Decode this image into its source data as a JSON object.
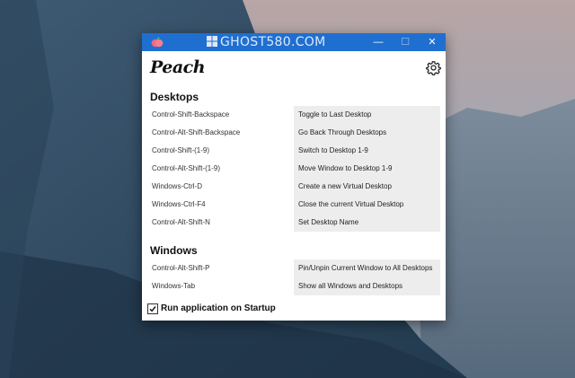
{
  "window": {
    "watermark_text": "GHOST580.COM",
    "minimize_glyph": "—",
    "maximize_glyph": "☐",
    "close_glyph": "✕"
  },
  "app": {
    "logo_text": "Peach",
    "settings_icon": "gear-icon",
    "icon": "peach-icon"
  },
  "sections": {
    "desktops": {
      "title": "Desktops",
      "rows": [
        {
          "shortcut": "Control-Shift-Backspace",
          "action": "Toggle to Last Desktop"
        },
        {
          "shortcut": "Control-Alt-Shift-Backspace",
          "action": "Go Back Through Desktops"
        },
        {
          "shortcut": "Control-Shift-(1-9)",
          "action": "Switch to Desktop 1-9"
        },
        {
          "shortcut": "Control-Alt-Shift-(1-9)",
          "action": "Move Window to Desktop 1-9"
        },
        {
          "shortcut": "Windows-Ctrl-D",
          "action": "Create a new Virtual Desktop"
        },
        {
          "shortcut": "Windows-Ctrl-F4",
          "action": "Close the current Virtual Desktop"
        },
        {
          "shortcut": "Control-Alt-Shift-N",
          "action": "Set Desktop Name"
        }
      ]
    },
    "windows": {
      "title": "Windows",
      "rows": [
        {
          "shortcut": "Control-Alt-Shift-P",
          "action": "Pin/Unpin Current Window to All Desktops"
        },
        {
          "shortcut": "Windows-Tab",
          "action": "Show all Windows and Desktops"
        }
      ]
    }
  },
  "startup": {
    "label": "Run application on Startup",
    "checked": true
  },
  "colors": {
    "titlebar": "#1f6fd1",
    "action_bg": "#ededed"
  }
}
